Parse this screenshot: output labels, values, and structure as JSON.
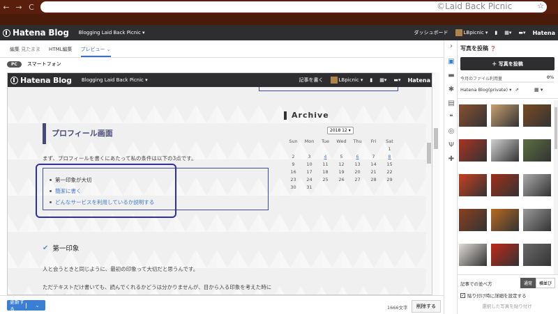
{
  "browser": {
    "back": "←",
    "forward": "→",
    "reload": "C",
    "watermark": "©Laid Back Picnic"
  },
  "header": {
    "logo": "Hatena Blog",
    "blog_selector": "Blogging Laid Back Picnic ▾",
    "dashboard": "ダッシュボード",
    "user": "LBpicnic ▾",
    "brand": "Hatena"
  },
  "editor_tabs": {
    "edit": "編集",
    "edit_sub": "見たまま",
    "html": "HTML編集",
    "preview": "プレビュー"
  },
  "device_tabs": {
    "pc": "PC",
    "smartphone": "スマートフォン"
  },
  "preview_bar": {
    "logo": "Hatena Blog",
    "blog": "Blogging Laid Back Picnic ▾",
    "write": "記事を書く",
    "user": "LBpicnic ▾",
    "brand": "Hatena"
  },
  "article": {
    "h2": "プロフィール画面",
    "intro": "まず、プロフィールを書くにあたって私の条件は以下の3点です。",
    "list": [
      "第一印象が大切",
      "簡潔に書く",
      "どんなサービスを利用しているか説明する"
    ],
    "h3": "第一印象",
    "p2": "人と会うときと同じように、最初の印象って大切だと思うんです。",
    "p3": "ただテキストだけ書いても、読んでくれるかどうは分かりませんが、目から入る印象を考えた時にデザイン設定に気づきました。"
  },
  "archive": {
    "title": "Archive",
    "month": "2018 12 ▾",
    "days": [
      "Sun",
      "Mon",
      "Tue",
      "Wed",
      "Thu",
      "Fri",
      "Sat"
    ],
    "weeks": [
      [
        "",
        "",
        "",
        "",
        "",
        "",
        "1"
      ],
      [
        "2",
        "3",
        "4",
        "5",
        "6",
        "7",
        "8"
      ],
      [
        "9",
        "10",
        "11",
        "12",
        "13",
        "14",
        "15"
      ],
      [
        "16",
        "17",
        "18",
        "19",
        "20",
        "21",
        "22"
      ],
      [
        "23",
        "24",
        "25",
        "26",
        "27",
        "28",
        "29"
      ],
      [
        "30",
        "31",
        "",
        "",
        "",
        "",
        ""
      ]
    ]
  },
  "bottom": {
    "update": "更新する",
    "chars": "1666文字",
    "delete": "削除する"
  },
  "sidebar": {
    "title": "写真を投稿",
    "post_button": "＋ 写真を投稿",
    "usage_label": "今月のファイル利用量",
    "usage_value": "0%",
    "blog_select": "Hatena Blog(private) ▾",
    "order_label": "記事での並べ方",
    "order_normal": "通常",
    "order_side": "横並び",
    "detail_label": "貼り付け時に詳細を設定する",
    "paste_button": "選択した写真を貼り付け"
  },
  "photo_colors": [
    "#8a5030",
    "#c8a070",
    "#7a4a22",
    "#aa3322",
    "#d0d0d0",
    "#5a7040",
    "#c84020",
    "#a03018",
    "#aaaaaa",
    "#8a4020",
    "#b86a20",
    "#9a9a9a",
    "#e0dcd8",
    "#c02818",
    "#6a6a6a"
  ]
}
